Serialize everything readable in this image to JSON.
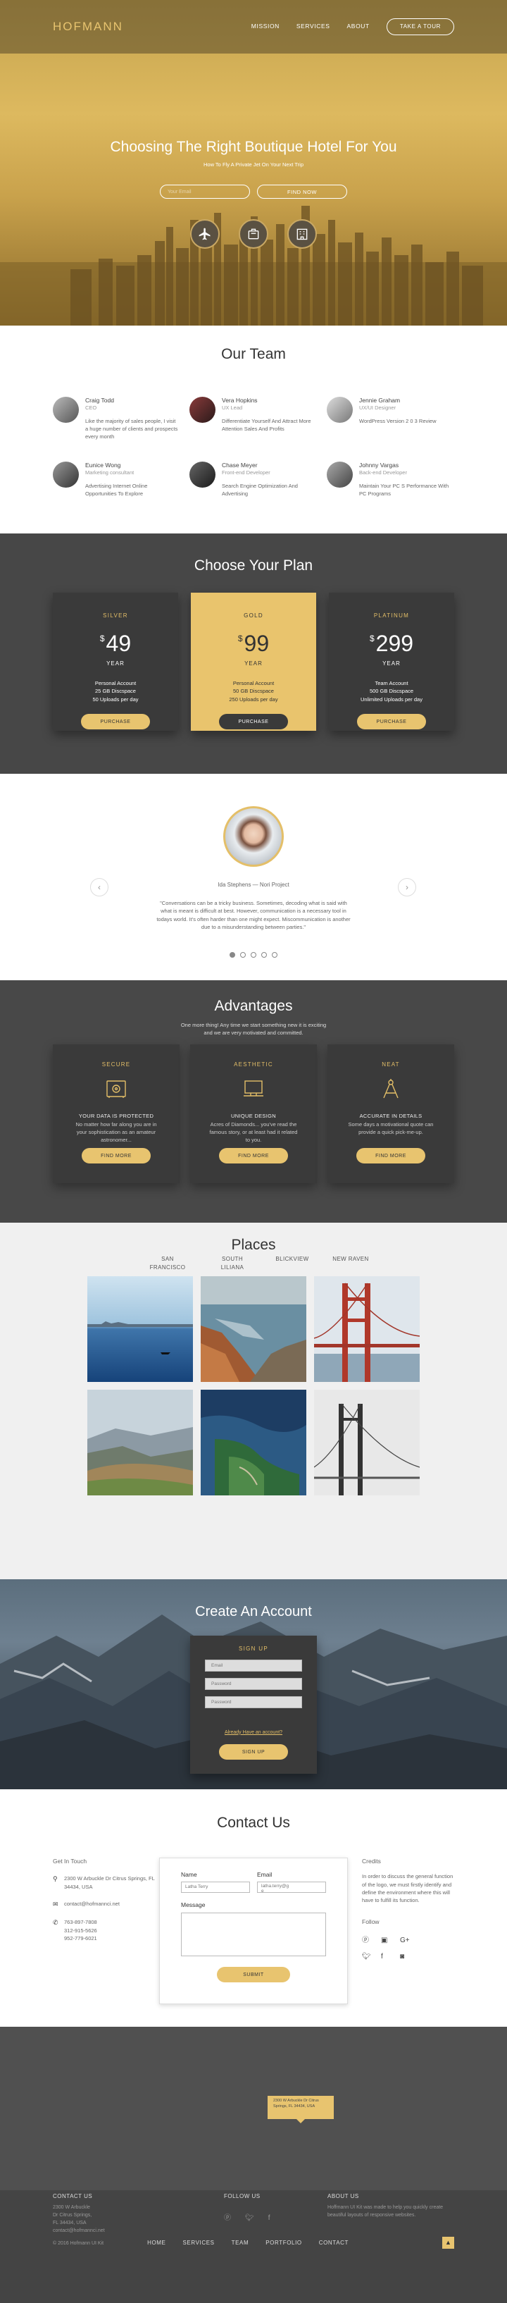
{
  "nav": {
    "logo": "HOFMANN",
    "links": [
      "MISSION",
      "SERVICES",
      "ABOUT"
    ],
    "tour_button": "TAKE A TOUR"
  },
  "hero": {
    "title": "Choosing The Right Boutique Hotel For You",
    "subtitle": "How To Fly A Private Jet On Your Next Trip",
    "email_placeholder": "Your Email",
    "cta": "FIND NOW",
    "icons": [
      "airplane-icon",
      "luggage-icon",
      "building-icon"
    ]
  },
  "team": {
    "title": "Our Team",
    "members": [
      {
        "name": "Craig Todd",
        "role": "CEO",
        "text": "Like the majority of sales people, I visit a huge number of clients and prospects every month"
      },
      {
        "name": "Vera Hopkins",
        "role": "UX Lead",
        "text": "Differentiate Yourself And Attract More Attention Sales And Profits"
      },
      {
        "name": "Jennie Graham",
        "role": "UX/UI Designer",
        "text": "WordPress Version 2 0 3 Review"
      },
      {
        "name": "Eunice Wong",
        "role": "Marketing consultant",
        "text": "Advertising Internet Online Opportunities To Explore"
      },
      {
        "name": "Chase Meyer",
        "role": "Front-end Developer",
        "text": "Search Engine Optimization And Advertising"
      },
      {
        "name": "Johnny Vargas",
        "role": "Back-end Developer",
        "text": "Maintain Your PC S Performance With PC Programs"
      }
    ]
  },
  "plans": {
    "title": "Choose Your Plan",
    "items": [
      {
        "name": "SILVER",
        "currency": "$",
        "price": "49",
        "period": "YEAR",
        "features": [
          "Personal Account",
          "25 GB Discspace",
          "50 Uploads per day"
        ],
        "button": "PURCHASE"
      },
      {
        "name": "GOLD",
        "currency": "$",
        "price": "99",
        "period": "YEAR",
        "features": [
          "Personal Account",
          "50 GB Discspace",
          "250 Uploads per day"
        ],
        "button": "PURCHASE"
      },
      {
        "name": "PLATINUM",
        "currency": "$",
        "price": "299",
        "period": "YEAR",
        "features": [
          "Team Account",
          "500 GB Discspace",
          "Unlimited Uploads per day"
        ],
        "button": "PURCHASE"
      }
    ]
  },
  "testimonial": {
    "author": "Ida Stephens — Nori Project",
    "quote": "\"Conversations can be a tricky business. Sometimes, decoding what is said with what is meant is difficult at best. However, communication is a necessary tool in todays world. It's often harder than one might expect. Miscommunication is another due to a misunderstanding between parties.\"",
    "dots": 5,
    "active_dot": 0
  },
  "advantages": {
    "title": "Advantages",
    "intro": "One more thing! Any time we start something new it is exciting and we are very motivated and committed.",
    "items": [
      {
        "title": "SECURE",
        "icon": "safe-icon",
        "subtitle": "YOUR DATA IS PROTECTED",
        "text": "No matter how far along you are in your sophistication as an amateur astronomer...",
        "button": "FIND MORE"
      },
      {
        "title": "AESTHETIC",
        "icon": "monitor-icon",
        "subtitle": "UNIQUE DESIGN",
        "text": "Acres of Diamonds... you've read the famous story, or at least had it related to you.",
        "button": "FIND MORE"
      },
      {
        "title": "NEAT",
        "icon": "compass-icon",
        "subtitle": "ACCURATE IN DETAILS",
        "text": "Some days a motivational quote can provide a quick pick-me-up.",
        "button": "FIND MORE"
      }
    ]
  },
  "places": {
    "title": "Places",
    "filters": [
      "SAN FRANCISCO",
      "SOUTH LILIANA",
      "BLICKVIEW",
      "NEW RAVEN"
    ]
  },
  "account": {
    "title": "Create An Account",
    "card_title": "SIGN UP",
    "fields": [
      "Email",
      "Password",
      "Password"
    ],
    "link": "Already Have an account?",
    "button": "SIGN UP"
  },
  "contact": {
    "title": "Contact Us",
    "get_in_touch": "Get In Touch",
    "address": "2300 W Arbuckle Dr Citrus Springs, FL 34434, USA",
    "email": "contact@hofmannci.net",
    "phones": "763-897-7808\n312-915-5626\n952-779-6021",
    "form": {
      "name_label": "Name",
      "name_value": "Latha Terry",
      "email_label": "Email",
      "email_value": "latha.terry@g\ne",
      "message_label": "Message",
      "button": "SUBMIT"
    },
    "credits_title": "Credits",
    "credits_text": "In order to discuss the general function of the logo, we must firstly identify and define the environment where this will have to fulfill its function.",
    "follow": "Follow",
    "social": [
      "pinterest-icon",
      "linkedin-icon",
      "googleplus-icon",
      "twitter-icon",
      "facebook-icon",
      "instagram-icon"
    ]
  },
  "map": {
    "pin": "2300 W Arbuckle Dr Citrus Springs, FL 34434, USA"
  },
  "footer": {
    "contact_title": "CONTACT US",
    "contact_text": "2300 W Arbuckle\nDr Citrus Springs,\nFL 34434, USA\ncontact@hofmannci.net",
    "follow_title": "FOLLOW US",
    "about_title": "ABOUT US",
    "about_text": "Hoffmann UI Kit was made to help you quickly create beautiful layouts of responsive websites.",
    "copyright": "© 2016 Hofmann UI Kit",
    "links": [
      "HOME",
      "SERVICES",
      "TEAM",
      "PORTFOLIO",
      "CONTACT"
    ],
    "up": "▲"
  },
  "colors": {
    "accent": "#e8c46f",
    "dark": "#3a3a3a",
    "section_dark": "#474747"
  }
}
